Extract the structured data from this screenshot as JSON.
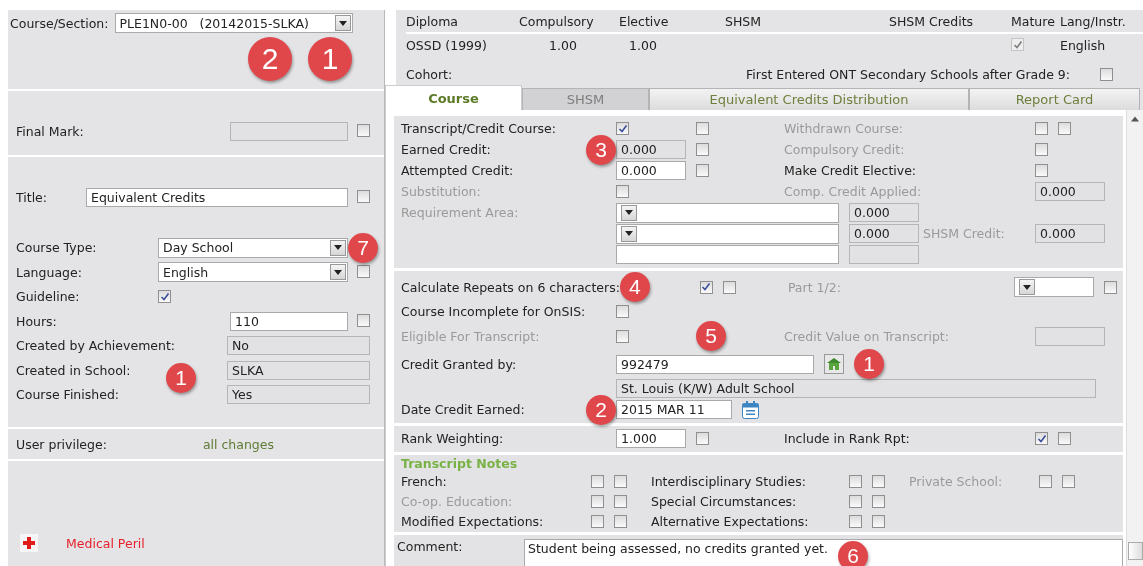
{
  "course_section": {
    "label": "Course/Section:",
    "value": "PLE1N0-00   (20142015-SLKA)",
    "callouts": [
      "2",
      "1"
    ]
  },
  "left_rows": [
    {
      "kind": "readonly",
      "label": "Final Mark:",
      "checked": false
    },
    {
      "kind": "text_wide",
      "label": "Title:",
      "value": "Equivalent Credits",
      "checked": false
    },
    {
      "kind": "select",
      "label": "Course Type:",
      "value": "Day School",
      "callout": "7"
    },
    {
      "kind": "select",
      "label": "Language:",
      "value": "English",
      "checked": false
    },
    {
      "kind": "check",
      "label": "Guideline:",
      "checked": true
    },
    {
      "kind": "text",
      "label": "Hours:",
      "value": "110",
      "checked": false
    },
    {
      "kind": "info",
      "label": "Created by Achievement:",
      "value": "No"
    },
    {
      "kind": "info",
      "label": "Created in School:",
      "value": "SLKA",
      "callout": "1"
    },
    {
      "kind": "info",
      "label": "Course Finished:",
      "value": "Yes"
    }
  ],
  "user_privilege": {
    "label": "User privilege:",
    "value": "all changes"
  },
  "medical": {
    "label": "Medical Peril"
  },
  "diploma": {
    "columns": [
      "Diploma",
      "Compulsory",
      "Elective",
      "SHSM",
      "SHSM Credits",
      "Mature",
      "Lang/Instr."
    ],
    "row": {
      "diploma": "OSSD (1999)",
      "compulsory": "1.00",
      "elective": "1.00",
      "mature": {
        "checked": true,
        "disabled": true
      },
      "language": "English"
    }
  },
  "cohort": {
    "label": "Cohort:",
    "first_entered_label": "First Entered ONT Secondary Schools after Grade 9:",
    "first_entered_checked": false
  },
  "tabs": [
    {
      "label": "Course",
      "selected": true,
      "disabled": false
    },
    {
      "label": "SHSM",
      "selected": false,
      "disabled": true
    },
    {
      "label": "Equivalent Credits Distribution",
      "selected": false,
      "disabled": false
    },
    {
      "label": "Report Card",
      "selected": false,
      "disabled": false
    }
  ],
  "sections": [
    {
      "rows": [
        {
          "label": {
            "text": "Transcript/Credit Course:",
            "disabled": false
          },
          "controls": [
            {
              "kind": "check",
              "checked": true
            },
            {
              "kind": "check",
              "checked": false
            }
          ],
          "label2": {
            "text": "Withdrawn Course:",
            "disabled": true
          },
          "controls2": [
            {
              "kind": "check",
              "checked": false
            },
            {
              "kind": "check",
              "checked": false
            }
          ]
        },
        {
          "label": {
            "text": "Earned Credit:",
            "disabled": false,
            "callout": "3"
          },
          "controls": [
            {
              "kind": "readonly",
              "value": "0.000"
            },
            {
              "kind": "check",
              "checked": false
            }
          ],
          "label2": {
            "text": "Compulsory Credit:",
            "disabled": true
          },
          "controls2": [
            {
              "kind": "check",
              "checked": false
            }
          ]
        },
        {
          "label": {
            "text": "Attempted Credit:",
            "disabled": false
          },
          "controls": [
            {
              "kind": "input",
              "value": "0.000"
            },
            {
              "kind": "check",
              "checked": false
            }
          ],
          "label2": {
            "text": "Make Credit Elective:",
            "disabled": false
          },
          "controls2": [
            {
              "kind": "check",
              "checked": false
            }
          ]
        },
        {
          "label": {
            "text": "Substitution:",
            "disabled": true
          },
          "controls": [
            {
              "kind": "check",
              "checked": false
            }
          ],
          "label2": {
            "text": "Comp. Credit Applied:",
            "disabled": true
          },
          "controls2": [
            {
              "kind": "readonly",
              "value": "0.000"
            }
          ]
        },
        {
          "label": {
            "text": "Requirement Area:",
            "disabled": true
          },
          "controls": [
            {
              "kind": "select"
            },
            {
              "kind": "readonly",
              "value": "0.000"
            }
          ]
        },
        {
          "controls": [
            {
              "kind": "select"
            },
            {
              "kind": "readonly",
              "value": "0.000"
            }
          ],
          "label2": {
            "text": "SHSM Credit:",
            "disabled": true
          },
          "controls2": [
            {
              "kind": "readonly",
              "value": "0.000"
            }
          ]
        },
        {
          "controls": [
            {
              "kind": "input"
            },
            {
              "kind": "readonly"
            }
          ]
        }
      ]
    },
    {
      "rows": [
        {
          "label": {
            "text": "Calculate Repeats on 6 characters:",
            "disabled": false
          },
          "controls": [
            {
              "kind": "callout",
              "text": "4"
            },
            {
              "kind": "check",
              "checked": true
            },
            {
              "kind": "check",
              "checked": false
            }
          ],
          "label2": {
            "text": "Part 1/2:",
            "disabled": true
          },
          "controls2": [
            {
              "kind": "select"
            },
            {
              "kind": "check",
              "checked": false
            }
          ]
        },
        {
          "label": {
            "text": "Course Incomplete for OnSIS:",
            "disabled": false
          },
          "controls": [
            {
              "kind": "check",
              "checked": false
            }
          ]
        },
        {
          "label": {
            "text": "Eligible For Transcript:",
            "disabled": true
          },
          "controls": [
            {
              "kind": "check",
              "checked": false
            },
            {
              "kind": "callout",
              "text": "5"
            }
          ],
          "label2": {
            "text": "Credit Value on Transcript:",
            "disabled": true
          },
          "controls2": [
            {
              "kind": "readonly"
            }
          ]
        },
        {
          "label": {
            "text": "Credit Granted by:",
            "disabled": false
          },
          "controls": [
            {
              "kind": "input",
              "value": "992479"
            },
            {
              "kind": "lookup"
            },
            {
              "kind": "callout",
              "text": "1"
            }
          ]
        },
        {
          "controls": [
            {
              "kind": "readonly",
              "value": "St. Louis (K/W) Adult School"
            }
          ]
        },
        {
          "label": {
            "text": "Date Credit Earned:",
            "disabled": false,
            "callout": "2"
          },
          "controls": [
            {
              "kind": "input",
              "value": "2015 MAR 11"
            },
            {
              "kind": "calendar"
            }
          ]
        }
      ]
    },
    {
      "rows": [
        {
          "label": {
            "text": "Rank Weighting:",
            "disabled": false
          },
          "controls": [
            {
              "kind": "input",
              "value": "1.000"
            },
            {
              "kind": "check",
              "checked": false
            }
          ],
          "label2": {
            "text": "Include in Rank Rpt:",
            "disabled": false
          },
          "controls2": [
            {
              "kind": "check",
              "checked": true
            },
            {
              "kind": "check",
              "checked": false
            }
          ]
        }
      ]
    }
  ],
  "transcript_notes": {
    "title": "Transcript Notes",
    "rows": [
      [
        {
          "label": "French:",
          "disabled": false,
          "checks": [
            false,
            false
          ]
        },
        {
          "label": "Interdisciplinary Studies:",
          "disabled": false,
          "checks": [
            false,
            false
          ]
        },
        {
          "label": "Private School:",
          "disabled": true,
          "checks": [
            false,
            false
          ]
        }
      ],
      [
        {
          "label": "Co-op. Education:",
          "disabled": true,
          "checks": [
            false,
            false
          ]
        },
        {
          "label": "Special Circumstances:",
          "disabled": false,
          "checks": [
            false,
            false
          ]
        }
      ],
      [
        {
          "label": "Modified Expectations:",
          "disabled": false,
          "checks": [
            false,
            false
          ]
        },
        {
          "label": "Alternative Expectations:",
          "disabled": false,
          "checks": [
            false,
            false
          ]
        }
      ]
    ]
  },
  "comment": {
    "label": "Comment:",
    "value": "Student being assessed, no credits granted yet.",
    "callout": "6"
  }
}
